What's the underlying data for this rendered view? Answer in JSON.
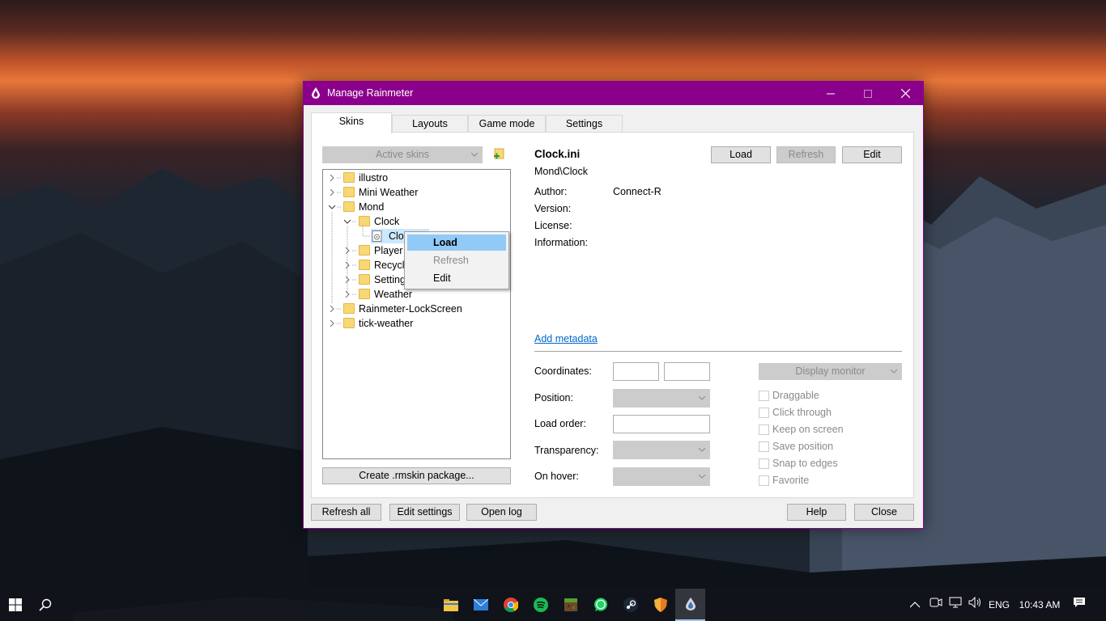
{
  "window": {
    "title": "Manage Rainmeter"
  },
  "tabs": [
    {
      "label": "Skins"
    },
    {
      "label": "Layouts"
    },
    {
      "label": "Game mode"
    },
    {
      "label": "Settings"
    }
  ],
  "skins_pane": {
    "filter_combo": "Active skins",
    "tree": [
      {
        "label": "illustro"
      },
      {
        "label": "Mini Weather"
      },
      {
        "label": "Mond"
      },
      {
        "label": "Clock"
      },
      {
        "label": "Clo"
      },
      {
        "label": "Player"
      },
      {
        "label": "Recycle"
      },
      {
        "label": "Setting"
      },
      {
        "label": "Weather"
      },
      {
        "label": "Rainmeter-LockScreen"
      },
      {
        "label": "tick-weather"
      }
    ],
    "create_package_label": "Create .rmskin package..."
  },
  "context_menu": {
    "items": [
      {
        "label": "Load"
      },
      {
        "label": "Refresh"
      },
      {
        "label": "Edit"
      }
    ]
  },
  "details": {
    "file_name": "Clock.ini",
    "path": "Mond\\Clock",
    "load_label": "Load",
    "refresh_label": "Refresh",
    "edit_label": "Edit",
    "author_label": "Author:",
    "author_value": "Connect-R",
    "version_label": "Version:",
    "license_label": "License:",
    "information_label": "Information:",
    "add_metadata": "Add metadata",
    "coordinates_label": "Coordinates:",
    "position_label": "Position:",
    "load_order_label": "Load order:",
    "transparency_label": "Transparency:",
    "on_hover_label": "On hover:",
    "display_monitor": "Display monitor",
    "checkboxes": [
      {
        "label": "Draggable"
      },
      {
        "label": "Click through"
      },
      {
        "label": "Keep on screen"
      },
      {
        "label": "Save position"
      },
      {
        "label": "Snap to edges"
      },
      {
        "label": "Favorite"
      }
    ]
  },
  "footer": {
    "refresh_all": "Refresh all",
    "edit_settings": "Edit settings",
    "open_log": "Open log",
    "help": "Help",
    "close": "Close"
  },
  "taskbar": {
    "language": "ENG",
    "time": "10:43 AM"
  },
  "colors": {
    "titlebar": "#8b008b",
    "link": "#0066cc",
    "highlight": "#91c9f7"
  }
}
